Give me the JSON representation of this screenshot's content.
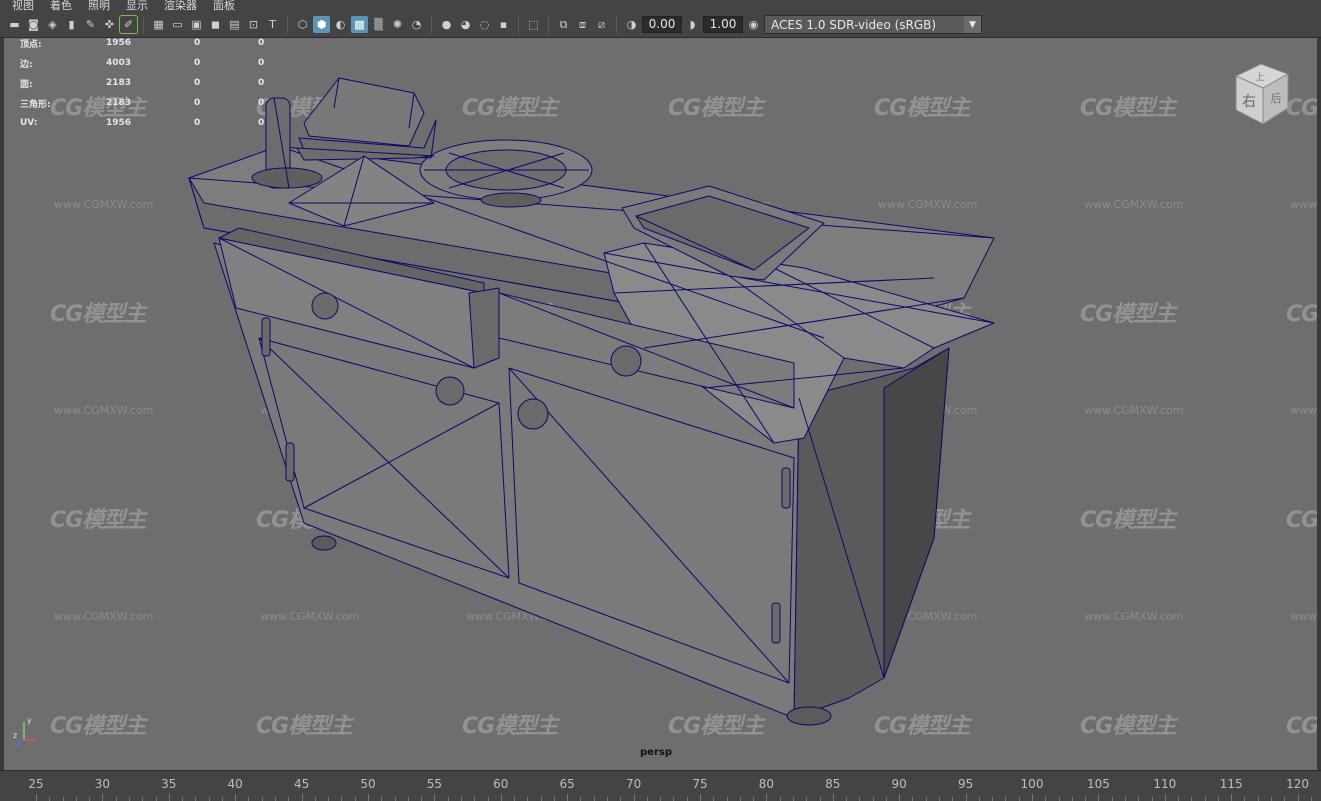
{
  "menu": [
    "视图",
    "着色",
    "照明",
    "显示",
    "渲染器",
    "面板"
  ],
  "toolbar": {
    "exposure": "0.00",
    "gamma": "1.00",
    "color_space": "ACES 1.0 SDR-video (sRGB)"
  },
  "stats": [
    {
      "label": "顶点:",
      "value": "1956",
      "v2": "0",
      "v3": "0"
    },
    {
      "label": "边:",
      "value": "4003",
      "v2": "0",
      "v3": "0"
    },
    {
      "label": "面:",
      "value": "2183",
      "v2": "0",
      "v3": "0"
    },
    {
      "label": "三角形:",
      "value": "2183",
      "v2": "0",
      "v3": "0"
    },
    {
      "label": "UV:",
      "value": "1956",
      "v2": "0",
      "v3": "0"
    }
  ],
  "viewcube": {
    "top": "上",
    "front": "右",
    "side": "后"
  },
  "camera": "persp",
  "axis": {
    "y": "y",
    "z": "z"
  },
  "watermark": {
    "logo": "CG模型主",
    "url": "www.CGMXW.com"
  },
  "timeline": [
    "25",
    "30",
    "35",
    "40",
    "45",
    "50",
    "55",
    "60",
    "65",
    "70",
    "75",
    "80",
    "85",
    "90",
    "95",
    "100",
    "105",
    "110",
    "115",
    "120"
  ],
  "colors": {
    "wire": "#0a0a6a",
    "viewport_bg": "#6e6e6e",
    "ui_bg": "#444444",
    "active_icon": "#5a95b5"
  }
}
